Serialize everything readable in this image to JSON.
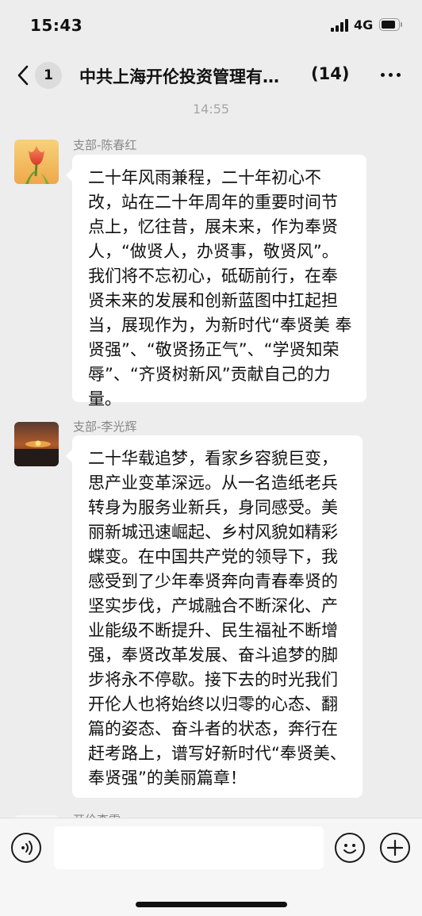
{
  "status_bar": {
    "time": "15:43",
    "network": "4G"
  },
  "header": {
    "back_count": "1",
    "title": "中共上海开伦投资管理有…",
    "member_count": "(14)"
  },
  "timestamp": "14:55",
  "messages": [
    {
      "sender": "支部-陈春红",
      "avatar": "tulip-avatar",
      "text": "二十年风雨兼程，二十年初心不改，站在二十年周年的重要时间节点上，忆往昔，展未来，作为奉贤人，“做贤人，办贤事，敬贤风”。我们将不忘初心，砥砺前行，在奉贤未来的发展和创新蓝图中扛起担当，展现作为，为新时代“奉贤美 奉贤强”、“敬贤扬正气”、“学贤知荣辱”、“齐贤树新风”贡献自己的力量。"
    },
    {
      "sender": "支部-李光辉",
      "avatar": "sunset-avatar",
      "text": "二十华载追梦，看家乡容貌巨变，思产业变革深远。从一名造纸老兵转身为服务业新兵，身同感受。美丽新城迅速崛起、乡村风貌如精彩蝶变。在中国共产党的领导下，我感受到了少年奉贤奔向青春奉贤的坚实步伐，产城融合不断深化、产业能级不断提升、民生福祉不断增强，奉贤改革发展、奋斗追梦的脚步将永不停歇。接下去的时光我们开伦人也将始终以归零的心态、翻篇的姿态、奋斗者的状态，奔行在赶考路上，谱写好新时代“奉贤美、奉贤强”的美丽篇章！"
    }
  ],
  "partial_next_sender": "开伦李雷",
  "input": {
    "value": "",
    "placeholder": ""
  },
  "icons": {
    "back": "chevron-left-icon",
    "more": "more-dots-icon",
    "voice": "voice-icon",
    "emoji": "emoji-icon",
    "plus": "plus-icon"
  },
  "colors": {
    "background": "#ededed",
    "bubble": "#ffffff",
    "secondary_text": "#888888"
  }
}
